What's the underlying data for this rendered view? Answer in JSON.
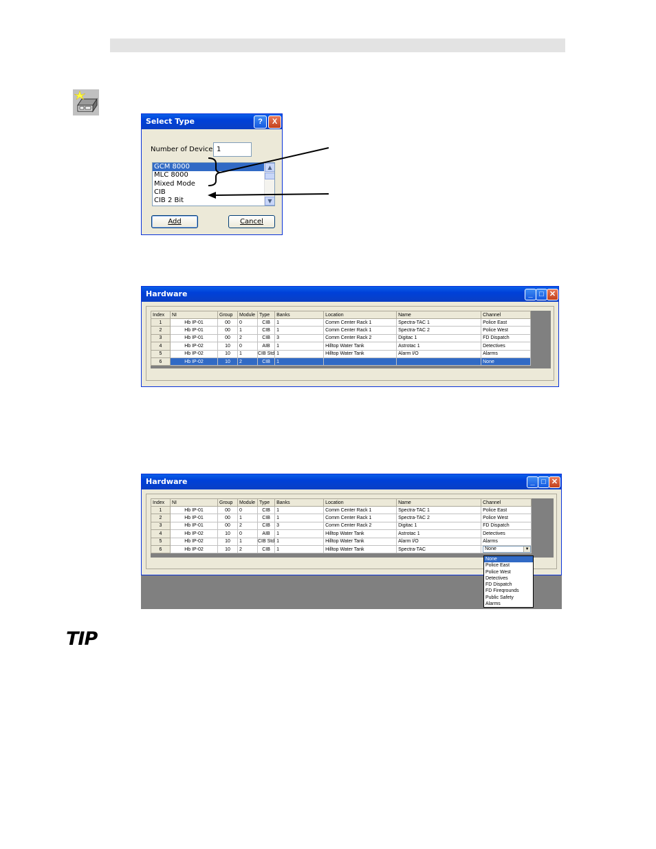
{
  "select_type_dialog": {
    "title": "Select Type",
    "help_button": "?",
    "close_button": "X",
    "num_devices_label": "Number of Devices:",
    "num_devices_value": "1",
    "types": [
      "GCM 8000",
      "MLC 8000",
      "Mixed Mode",
      "CIB",
      "CIB 2 Bit"
    ],
    "selected_type": "GCM 8000",
    "add_button": "Add",
    "cancel_button": "Cancel"
  },
  "hardware_window_1": {
    "title": "Hardware",
    "columns": [
      "Index",
      "NI",
      "Group",
      "Module",
      "Type",
      "Banks",
      "Location",
      "Name",
      "Channel"
    ],
    "rows": [
      [
        "1",
        "Hb IP-01",
        "00",
        "0",
        "CIB",
        "1",
        "Comm Center Rack 1",
        "Spectra-TAC 1",
        "Police East"
      ],
      [
        "2",
        "Hb IP-01",
        "00",
        "1",
        "CIB",
        "1",
        "Comm Center Rack 1",
        "Spectra-TAC 2",
        "Police West"
      ],
      [
        "3",
        "Hb IP-01",
        "00",
        "2",
        "CIB",
        "3",
        "Comm Center Rack 2",
        "Digitac 1",
        "FD Dispatch"
      ],
      [
        "4",
        "Hb IP-02",
        "10",
        "0",
        "AIB",
        "1",
        "Hilltop Water Tank",
        "Astrotac 1",
        "Detectives"
      ],
      [
        "5",
        "Hb IP-02",
        "10",
        "1",
        "CIB Std",
        "1",
        "Hilltop Water Tank",
        "Alarm I/O",
        "Alarms"
      ],
      [
        "6",
        "Hb IP-02",
        "10",
        "2",
        "CIB",
        "1",
        "",
        "",
        "None"
      ]
    ]
  },
  "hardware_window_2": {
    "title": "Hardware",
    "columns": [
      "Index",
      "NI",
      "Group",
      "Module",
      "Type",
      "Banks",
      "Location",
      "Name",
      "Channel"
    ],
    "rows": [
      [
        "1",
        "Hb IP-01",
        "00",
        "0",
        "CIB",
        "1",
        "Comm Center Rack 1",
        "Spectra-TAC 1",
        "Police East"
      ],
      [
        "2",
        "Hb IP-01",
        "00",
        "1",
        "CIB",
        "1",
        "Comm Center Rack 1",
        "Spectra-TAC 2",
        "Police West"
      ],
      [
        "3",
        "Hb IP-01",
        "00",
        "2",
        "CIB",
        "3",
        "Comm Center Rack 2",
        "Digitac 1",
        "FD Dispatch"
      ],
      [
        "4",
        "Hb IP-02",
        "10",
        "0",
        "AIB",
        "1",
        "Hilltop Water Tank",
        "Astrotac 1",
        "Detectives"
      ],
      [
        "5",
        "Hb IP-02",
        "10",
        "1",
        "CIB Std",
        "1",
        "Hilltop Water Tank",
        "Alarm I/O",
        "Alarms"
      ],
      [
        "6",
        "Hb IP-02",
        "10",
        "2",
        "CIB",
        "1",
        "Hilltop Water Tank",
        "Spectra-TAC",
        ""
      ]
    ],
    "channel_combo_value": "None",
    "channel_options": [
      "None",
      "Police East",
      "Police West",
      "Detectives",
      "FD Dispatch",
      "FD Fireqrounds",
      "Public Safety",
      "Alarms"
    ]
  },
  "tip_logo": "TIP",
  "colors": {
    "title_bar": "#0a4fe0",
    "selection": "#316ac5",
    "window_face": "#ece9d8",
    "grid_background": "#808080"
  }
}
